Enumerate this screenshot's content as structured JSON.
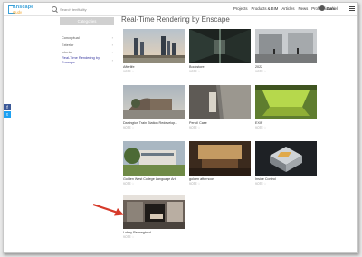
{
  "header": {
    "logo_line1": "Enscape",
    "logo_line2": "study",
    "search_placeholder": "Search tenfitality",
    "nav": [
      "Projects",
      "Products & BIM",
      "Articles",
      "News",
      "Professionals"
    ],
    "user_name": "Daniel"
  },
  "sidebar": {
    "title": "Categories",
    "items": [
      {
        "label": "Conceptual",
        "active": false
      },
      {
        "label": "Exterior",
        "active": false
      },
      {
        "label": "Interior",
        "active": false
      },
      {
        "label": "Real-Time Rendering by Enscape",
        "active": true
      }
    ]
  },
  "social": {
    "facebook": "f",
    "twitter": "t"
  },
  "page": {
    "title": "Real-Time Rendering by Enscape",
    "tiles": [
      {
        "title": "Afterlife",
        "meta": "VOTE ♡"
      },
      {
        "title": "Bookstore",
        "meta": "VOTE ♡"
      },
      {
        "title": "2022",
        "meta": "VOTE ♡"
      },
      {
        "title": "Darlington Train Station Redevelop...",
        "meta": "VOTE ♡"
      },
      {
        "title": "Pencil Case",
        "meta": "VOTE ♡"
      },
      {
        "title": "EXIF",
        "meta": "VOTE ♡"
      },
      {
        "title": "Golden West College Language Art",
        "meta": "VOTE ♡"
      },
      {
        "title": "golden afternoon",
        "meta": "VOTE ♡"
      },
      {
        "title": "Inside Control",
        "meta": "VOTE ♡"
      },
      {
        "title": "Lobby Reimagined",
        "meta": "VOTE ♡"
      }
    ]
  },
  "annotation_color": "#d63a2a"
}
